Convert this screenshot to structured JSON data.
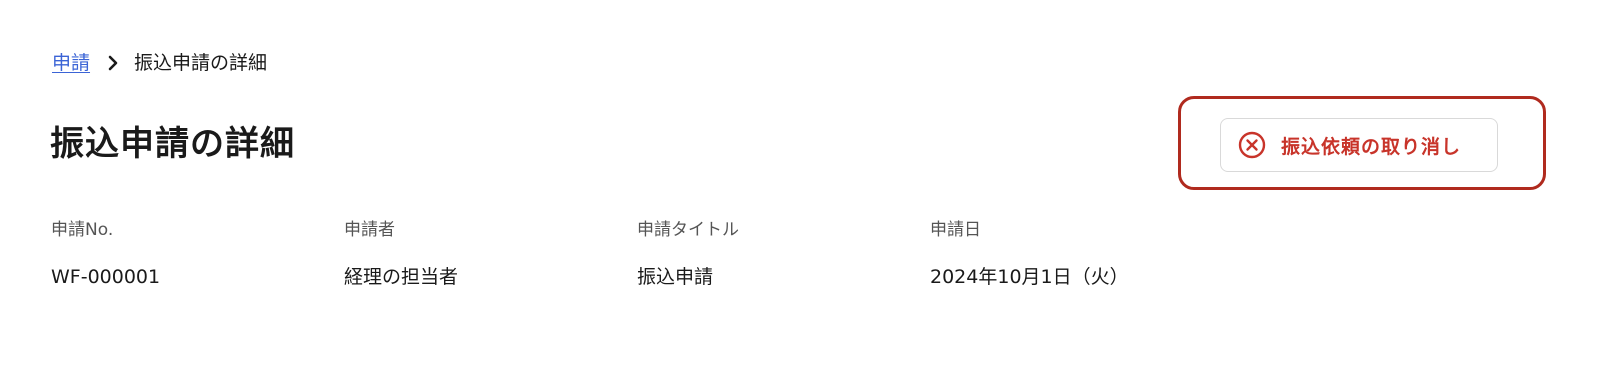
{
  "breadcrumb": {
    "parent_label": "申請",
    "current_label": "振込申請の詳細"
  },
  "header": {
    "title": "振込申請の詳細",
    "cancel_button_label": "振込依頼の取り消し"
  },
  "details": {
    "fields": [
      {
        "label": "申請No.",
        "value": "WF-000001"
      },
      {
        "label": "申請者",
        "value": "経理の担当者"
      },
      {
        "label": "申請タイトル",
        "value": "振込申請"
      },
      {
        "label": "申請日",
        "value": "2024年10月1日（火）"
      }
    ]
  },
  "colors": {
    "link": "#3b64d6",
    "danger": "#c8342a",
    "highlight_border": "#b02a1e"
  },
  "icons": {
    "breadcrumb_separator": "chevron-right-icon",
    "cancel": "circle-x-icon"
  }
}
